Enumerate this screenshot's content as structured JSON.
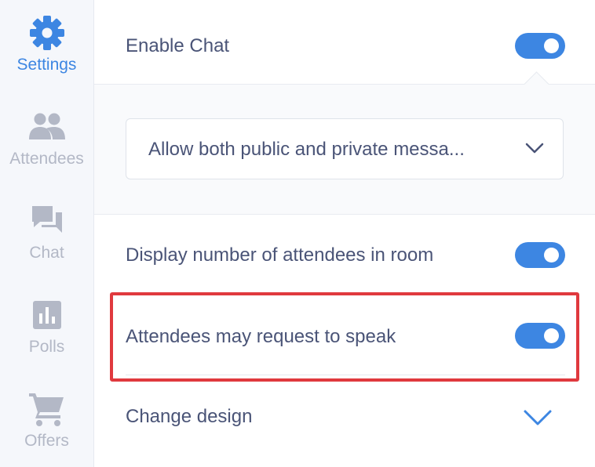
{
  "sidebar": {
    "items": [
      {
        "label": "Settings",
        "icon": "gear-icon",
        "active": true
      },
      {
        "label": "Attendees",
        "icon": "people-icon",
        "active": false
      },
      {
        "label": "Chat",
        "icon": "chat-icon",
        "active": false
      },
      {
        "label": "Polls",
        "icon": "poll-icon",
        "active": false
      },
      {
        "label": "Offers",
        "icon": "cart-icon",
        "active": false
      }
    ]
  },
  "settings": {
    "enable_chat": {
      "label": "Enable Chat",
      "enabled": true
    },
    "chat_mode": {
      "value": "Allow both public and private messa..."
    },
    "display_attendees": {
      "label": "Display number of attendees in room",
      "enabled": true
    },
    "request_speak": {
      "label": "Attendees may request to speak",
      "enabled": true
    },
    "change_design": {
      "label": "Change design"
    }
  },
  "colors": {
    "accent": "#3d86e2",
    "text": "#4a5477",
    "muted": "#b3b8c6",
    "highlight": "#e0393e",
    "sidebar_bg": "#f5f7fb"
  }
}
